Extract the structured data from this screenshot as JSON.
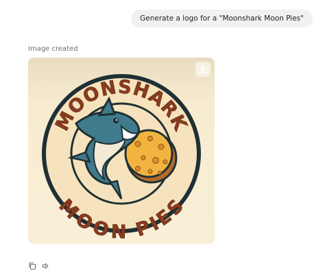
{
  "conversation": {
    "user_message": "Generate a logo for a \"Moonshark Moon Pies\"",
    "status_label": "Image created"
  },
  "logo": {
    "top_text": "MOONSHARK",
    "bottom_text": "MOON PIES"
  },
  "icons": {
    "download": "download-icon",
    "copy": "copy-icon",
    "read_aloud": "speaker-icon"
  },
  "colors": {
    "logo_background": "#f7ecd0",
    "ring_dark": "#1f3035",
    "ring_cream": "#f6e3bd",
    "lettering": "#8a3b1e",
    "shark_blue": "#3f7b8c",
    "pie_yellow": "#f2b440",
    "pie_crust": "#b56b2a"
  }
}
